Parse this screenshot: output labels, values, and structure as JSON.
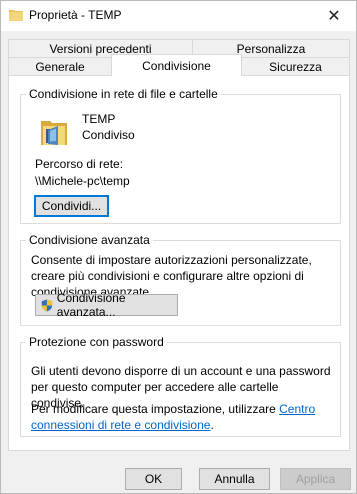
{
  "window": {
    "title": "Proprietà - TEMP",
    "close_glyph": "✕"
  },
  "tabs": {
    "row1": [
      {
        "label": "Versioni precedenti"
      },
      {
        "label": "Personalizza"
      }
    ],
    "row2": [
      {
        "label": "Generale"
      },
      {
        "label": "Condivisione",
        "active": true
      },
      {
        "label": "Sicurezza"
      }
    ]
  },
  "network_sharing": {
    "group_title": "Condivisione in rete di file e cartelle",
    "folder_name": "TEMP",
    "status": "Condiviso",
    "path_label": "Percorso di rete:",
    "path_value": "\\\\Michele-pc\\temp",
    "share_button": "Condividi..."
  },
  "advanced_sharing": {
    "group_title": "Condivisione avanzata",
    "description": "Consente di impostare autorizzazioni personalizzate, creare più condivisioni e configurare altre opzioni di condivisione avanzate.",
    "button": "Condivisione avanzata..."
  },
  "password_protection": {
    "group_title": "Protezione con password",
    "description": "Gli utenti devono disporre di un account e una password per questo computer per accedere alle cartelle condivise.",
    "change_text": "Per modificare questa impostazione, utilizzare",
    "link_part1": "Centro",
    "link_part2": "connessioni di rete e condivisione",
    "after_link": "."
  },
  "footer": {
    "ok": "OK",
    "cancel": "Annulla",
    "apply": "Applica"
  },
  "colors": {
    "accent": "#0078d7",
    "link": "#0066cc",
    "folder": "#e8c25a"
  },
  "icons": {
    "title_icon": "folder-icon",
    "share_folder_icon": "shared-folder-icon",
    "advanced_button_icon": "uac-shield-icon"
  }
}
